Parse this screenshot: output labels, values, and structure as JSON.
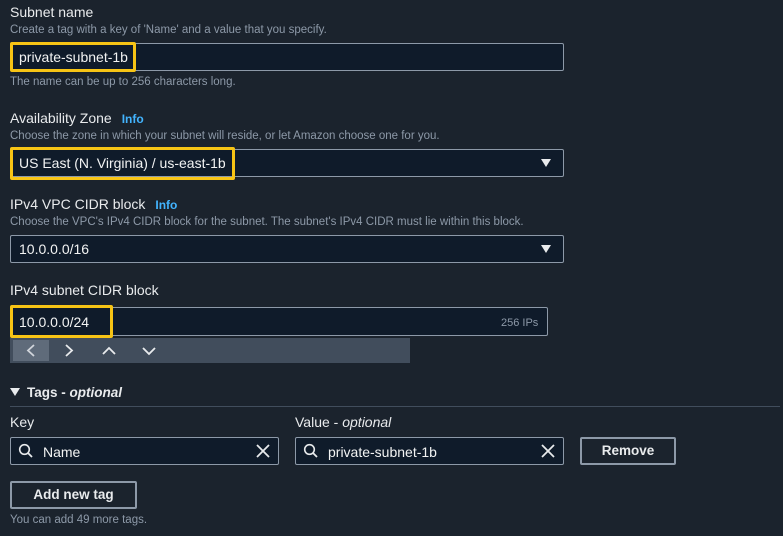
{
  "subnet_name": {
    "label": "Subnet name",
    "description": "Create a tag with a key of 'Name' and a value that you specify.",
    "value": "private-subnet-1b",
    "hint": "The name can be up to 256 characters long."
  },
  "availability_zone": {
    "label": "Availability Zone",
    "info": "Info",
    "description": "Choose the zone in which your subnet will reside, or let Amazon choose one for you.",
    "value": "US East (N. Virginia) / us-east-1b"
  },
  "vpc_cidr": {
    "label": "IPv4 VPC CIDR block",
    "info": "Info",
    "description": "Choose the VPC's IPv4 CIDR block for the subnet. The subnet's IPv4 CIDR must lie within this block.",
    "value": "10.0.0.0/16"
  },
  "subnet_cidr": {
    "label": "IPv4 subnet CIDR block",
    "value": "10.0.0.0/24",
    "ip_count": "256 IPs"
  },
  "tags": {
    "title": "Tags",
    "title_suffix": "optional",
    "key_label": "Key",
    "value_label": "Value",
    "value_label_suffix": "optional",
    "rows": [
      {
        "key": "Name",
        "value": "private-subnet-1b",
        "remove_label": "Remove"
      }
    ],
    "add_label": "Add new tag",
    "footer": "You can add 49 more tags."
  },
  "colors": {
    "highlight": "#f7c415",
    "info_link": "#42b4ff",
    "background": "#1b232d"
  }
}
